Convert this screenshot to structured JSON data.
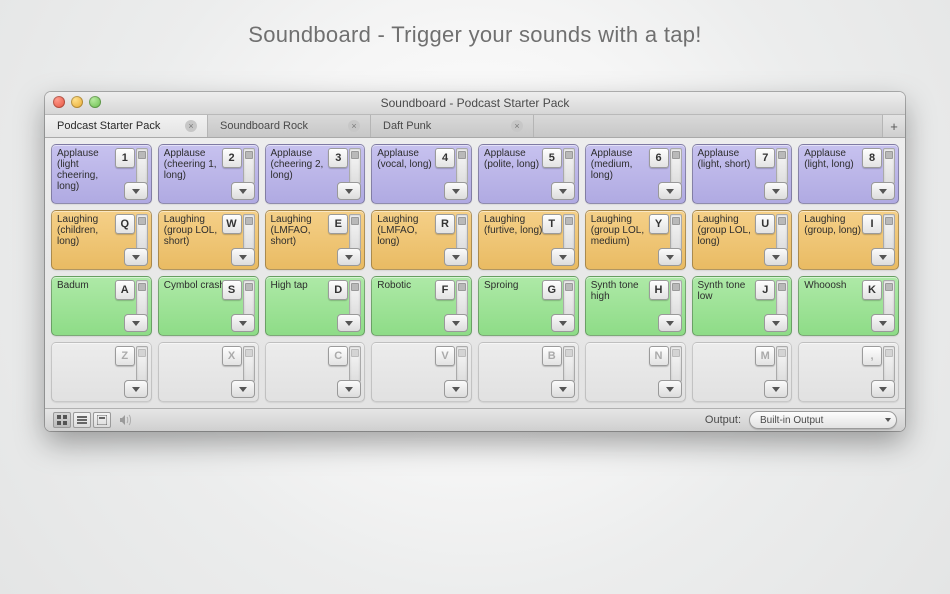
{
  "promo": {
    "title": "Soundboard - Trigger your sounds with a tap!"
  },
  "window": {
    "title": "Soundboard - Podcast Starter Pack"
  },
  "tabs": [
    {
      "label": "Podcast Starter Pack",
      "active": true
    },
    {
      "label": "Soundboard Rock",
      "active": false
    },
    {
      "label": "Daft Punk",
      "active": false
    }
  ],
  "ui": {
    "add_tab": "+",
    "close_x": "×",
    "output_label": "Output:",
    "output_value": "Built-in Output"
  },
  "rows": [
    {
      "color": "purple",
      "cells": [
        {
          "label": "Applause (light cheering, long)",
          "key": "1"
        },
        {
          "label": "Applause (cheering 1, long)",
          "key": "2"
        },
        {
          "label": "Applause (cheering 2, long)",
          "key": "3"
        },
        {
          "label": "Applause (vocal, long)",
          "key": "4"
        },
        {
          "label": "Applause (polite, long)",
          "key": "5"
        },
        {
          "label": "Applause (medium, long)",
          "key": "6"
        },
        {
          "label": "Applause (light, short)",
          "key": "7"
        },
        {
          "label": "Applause (light, long)",
          "key": "8"
        }
      ]
    },
    {
      "color": "orange",
      "cells": [
        {
          "label": "Laughing (children, long)",
          "key": "Q"
        },
        {
          "label": "Laughing (group LOL, short)",
          "key": "W"
        },
        {
          "label": "Laughing (LMFAO, short)",
          "key": "E"
        },
        {
          "label": "Laughing (LMFAO, long)",
          "key": "R"
        },
        {
          "label": "Laughing (furtive, long)",
          "key": "T"
        },
        {
          "label": "Laughing (group LOL, medium)",
          "key": "Y"
        },
        {
          "label": "Laughing (group LOL, long)",
          "key": "U"
        },
        {
          "label": "Laughing (group, long)",
          "key": "I"
        }
      ]
    },
    {
      "color": "green",
      "cells": [
        {
          "label": "Badum",
          "key": "A"
        },
        {
          "label": "Cymbol crash",
          "key": "S"
        },
        {
          "label": "High tap",
          "key": "D"
        },
        {
          "label": "Robotic",
          "key": "F"
        },
        {
          "label": "Sproing",
          "key": "G"
        },
        {
          "label": "Synth tone high",
          "key": "H"
        },
        {
          "label": "Synth tone low",
          "key": "J"
        },
        {
          "label": "Whooosh",
          "key": "K"
        }
      ]
    },
    {
      "color": "empty",
      "cells": [
        {
          "label": "",
          "key": "Z"
        },
        {
          "label": "",
          "key": "X"
        },
        {
          "label": "",
          "key": "C"
        },
        {
          "label": "",
          "key": "V"
        },
        {
          "label": "",
          "key": "B"
        },
        {
          "label": "",
          "key": "N"
        },
        {
          "label": "",
          "key": "M"
        },
        {
          "label": "",
          "key": ","
        }
      ]
    }
  ]
}
